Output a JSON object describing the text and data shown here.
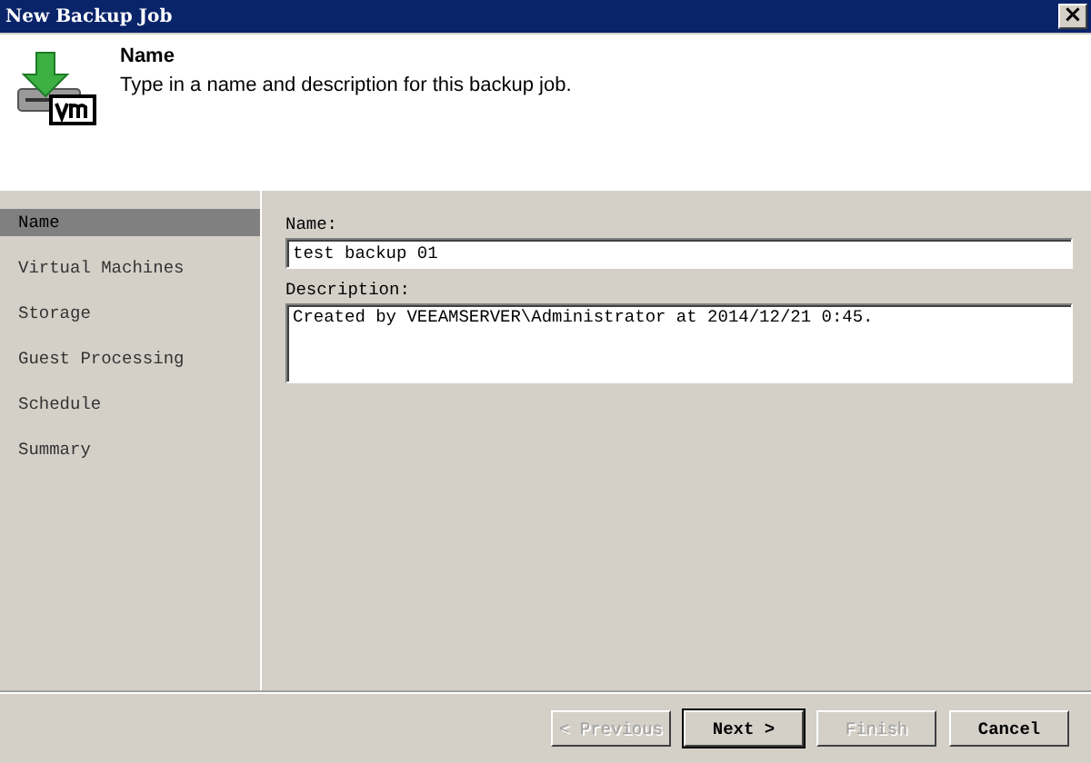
{
  "window": {
    "title": "New Backup Job",
    "close": "×"
  },
  "header": {
    "title": "Name",
    "description": "Type in a name and description for this backup job."
  },
  "sidebar": {
    "items": [
      {
        "label": "Name",
        "selected": true
      },
      {
        "label": "Virtual Machines",
        "selected": false
      },
      {
        "label": "Storage",
        "selected": false
      },
      {
        "label": "Guest Processing",
        "selected": false
      },
      {
        "label": "Schedule",
        "selected": false
      },
      {
        "label": "Summary",
        "selected": false
      }
    ]
  },
  "form": {
    "name_label": "Name:",
    "name_value": "test backup 01",
    "description_label": "Description:",
    "description_value": "Created by VEEAMSERVER\\Administrator at 2014/12/21 0:45."
  },
  "buttons": [
    {
      "label": "< Previous",
      "disabled": true,
      "default": false
    },
    {
      "label": "Next >",
      "disabled": false,
      "default": true
    },
    {
      "label": "Finish",
      "disabled": true,
      "default": false
    },
    {
      "label": "Cancel",
      "disabled": false,
      "default": false
    }
  ]
}
